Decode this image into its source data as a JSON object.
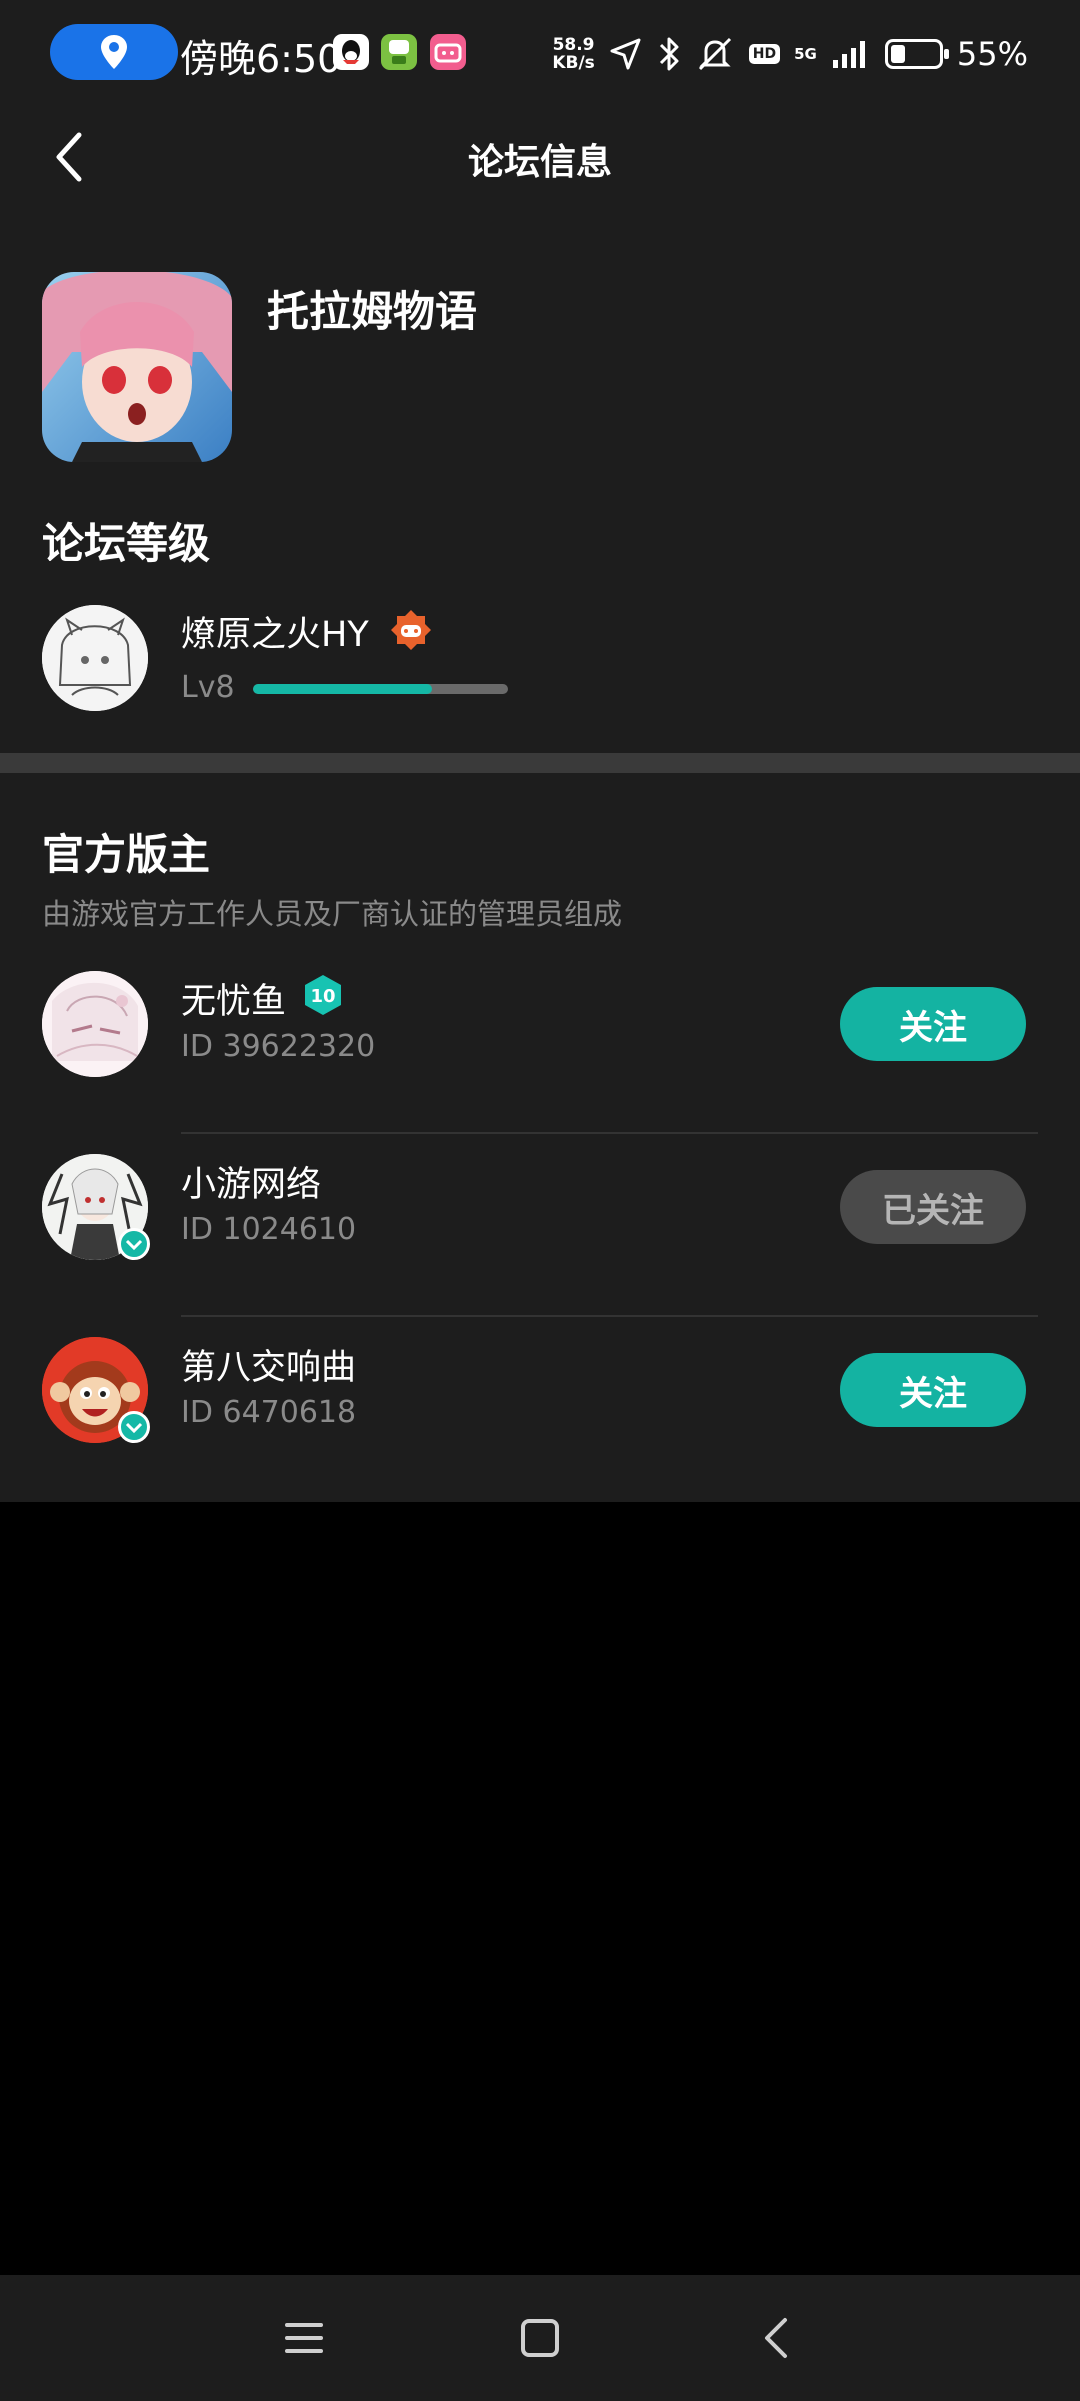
{
  "status_bar": {
    "time": "傍晚6:50",
    "net_speed_value": "58.9",
    "net_speed_unit": "KB/s",
    "hd_label": "HD",
    "network_label": "5G",
    "battery_pct": "55%",
    "battery_level": 0.55,
    "icons": [
      "location-icon",
      "qq-icon",
      "green-app-icon",
      "bilibili-icon",
      "navigation-arrow-icon",
      "bluetooth-icon",
      "mute-icon",
      "signal-icon",
      "battery-icon"
    ]
  },
  "header": {
    "title": "论坛信息",
    "back_icon": "chevron-left-icon"
  },
  "forum": {
    "game_name": "托拉姆物语",
    "level_section_title": "论坛等级",
    "me": {
      "name": "燎原之火HY",
      "level": "Lv8",
      "progress": 0.7,
      "badge_color": "#e8622c"
    }
  },
  "moderators": {
    "title": "官方版主",
    "subtitle": "由游戏官方工作人员及厂商认证的管理员组成",
    "items": [
      {
        "name": "无忧鱼",
        "id": "ID 39622320",
        "level_badge": "10",
        "verified": false,
        "button": "关注",
        "followed": false
      },
      {
        "name": "小游网络",
        "id": "ID 1024610",
        "level_badge": "",
        "verified": true,
        "button": "已关注",
        "followed": true
      },
      {
        "name": "第八交响曲",
        "id": "ID 6470618",
        "level_badge": "",
        "verified": true,
        "button": "关注",
        "followed": false
      }
    ]
  },
  "colors": {
    "accent": "#14b3a2",
    "background": "#1d1d1d",
    "muted_text": "#8a8a8a"
  },
  "nav_bar": {
    "icons": [
      "menu-icon",
      "home-icon",
      "back-icon"
    ]
  }
}
